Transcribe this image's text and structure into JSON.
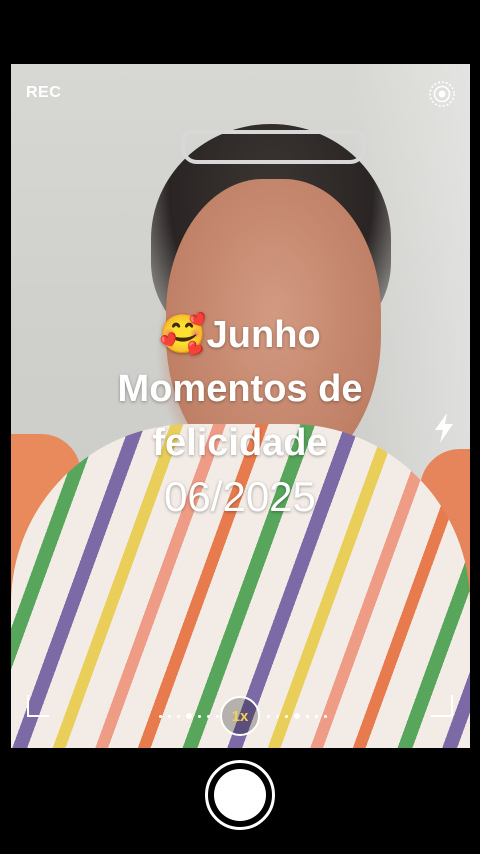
{
  "camera": {
    "rec_label": "REC",
    "live_icon": "live-photo-icon",
    "flash_icon": "flash-icon"
  },
  "caption": {
    "emoji": "🥰",
    "line1": "Junho",
    "line2": "Momentos de",
    "line3": "felicidade",
    "date": "06/2025"
  },
  "zoom": {
    "label": "1x",
    "accent": "#f3d34a"
  },
  "shutter": {
    "icon": "shutter-button"
  }
}
